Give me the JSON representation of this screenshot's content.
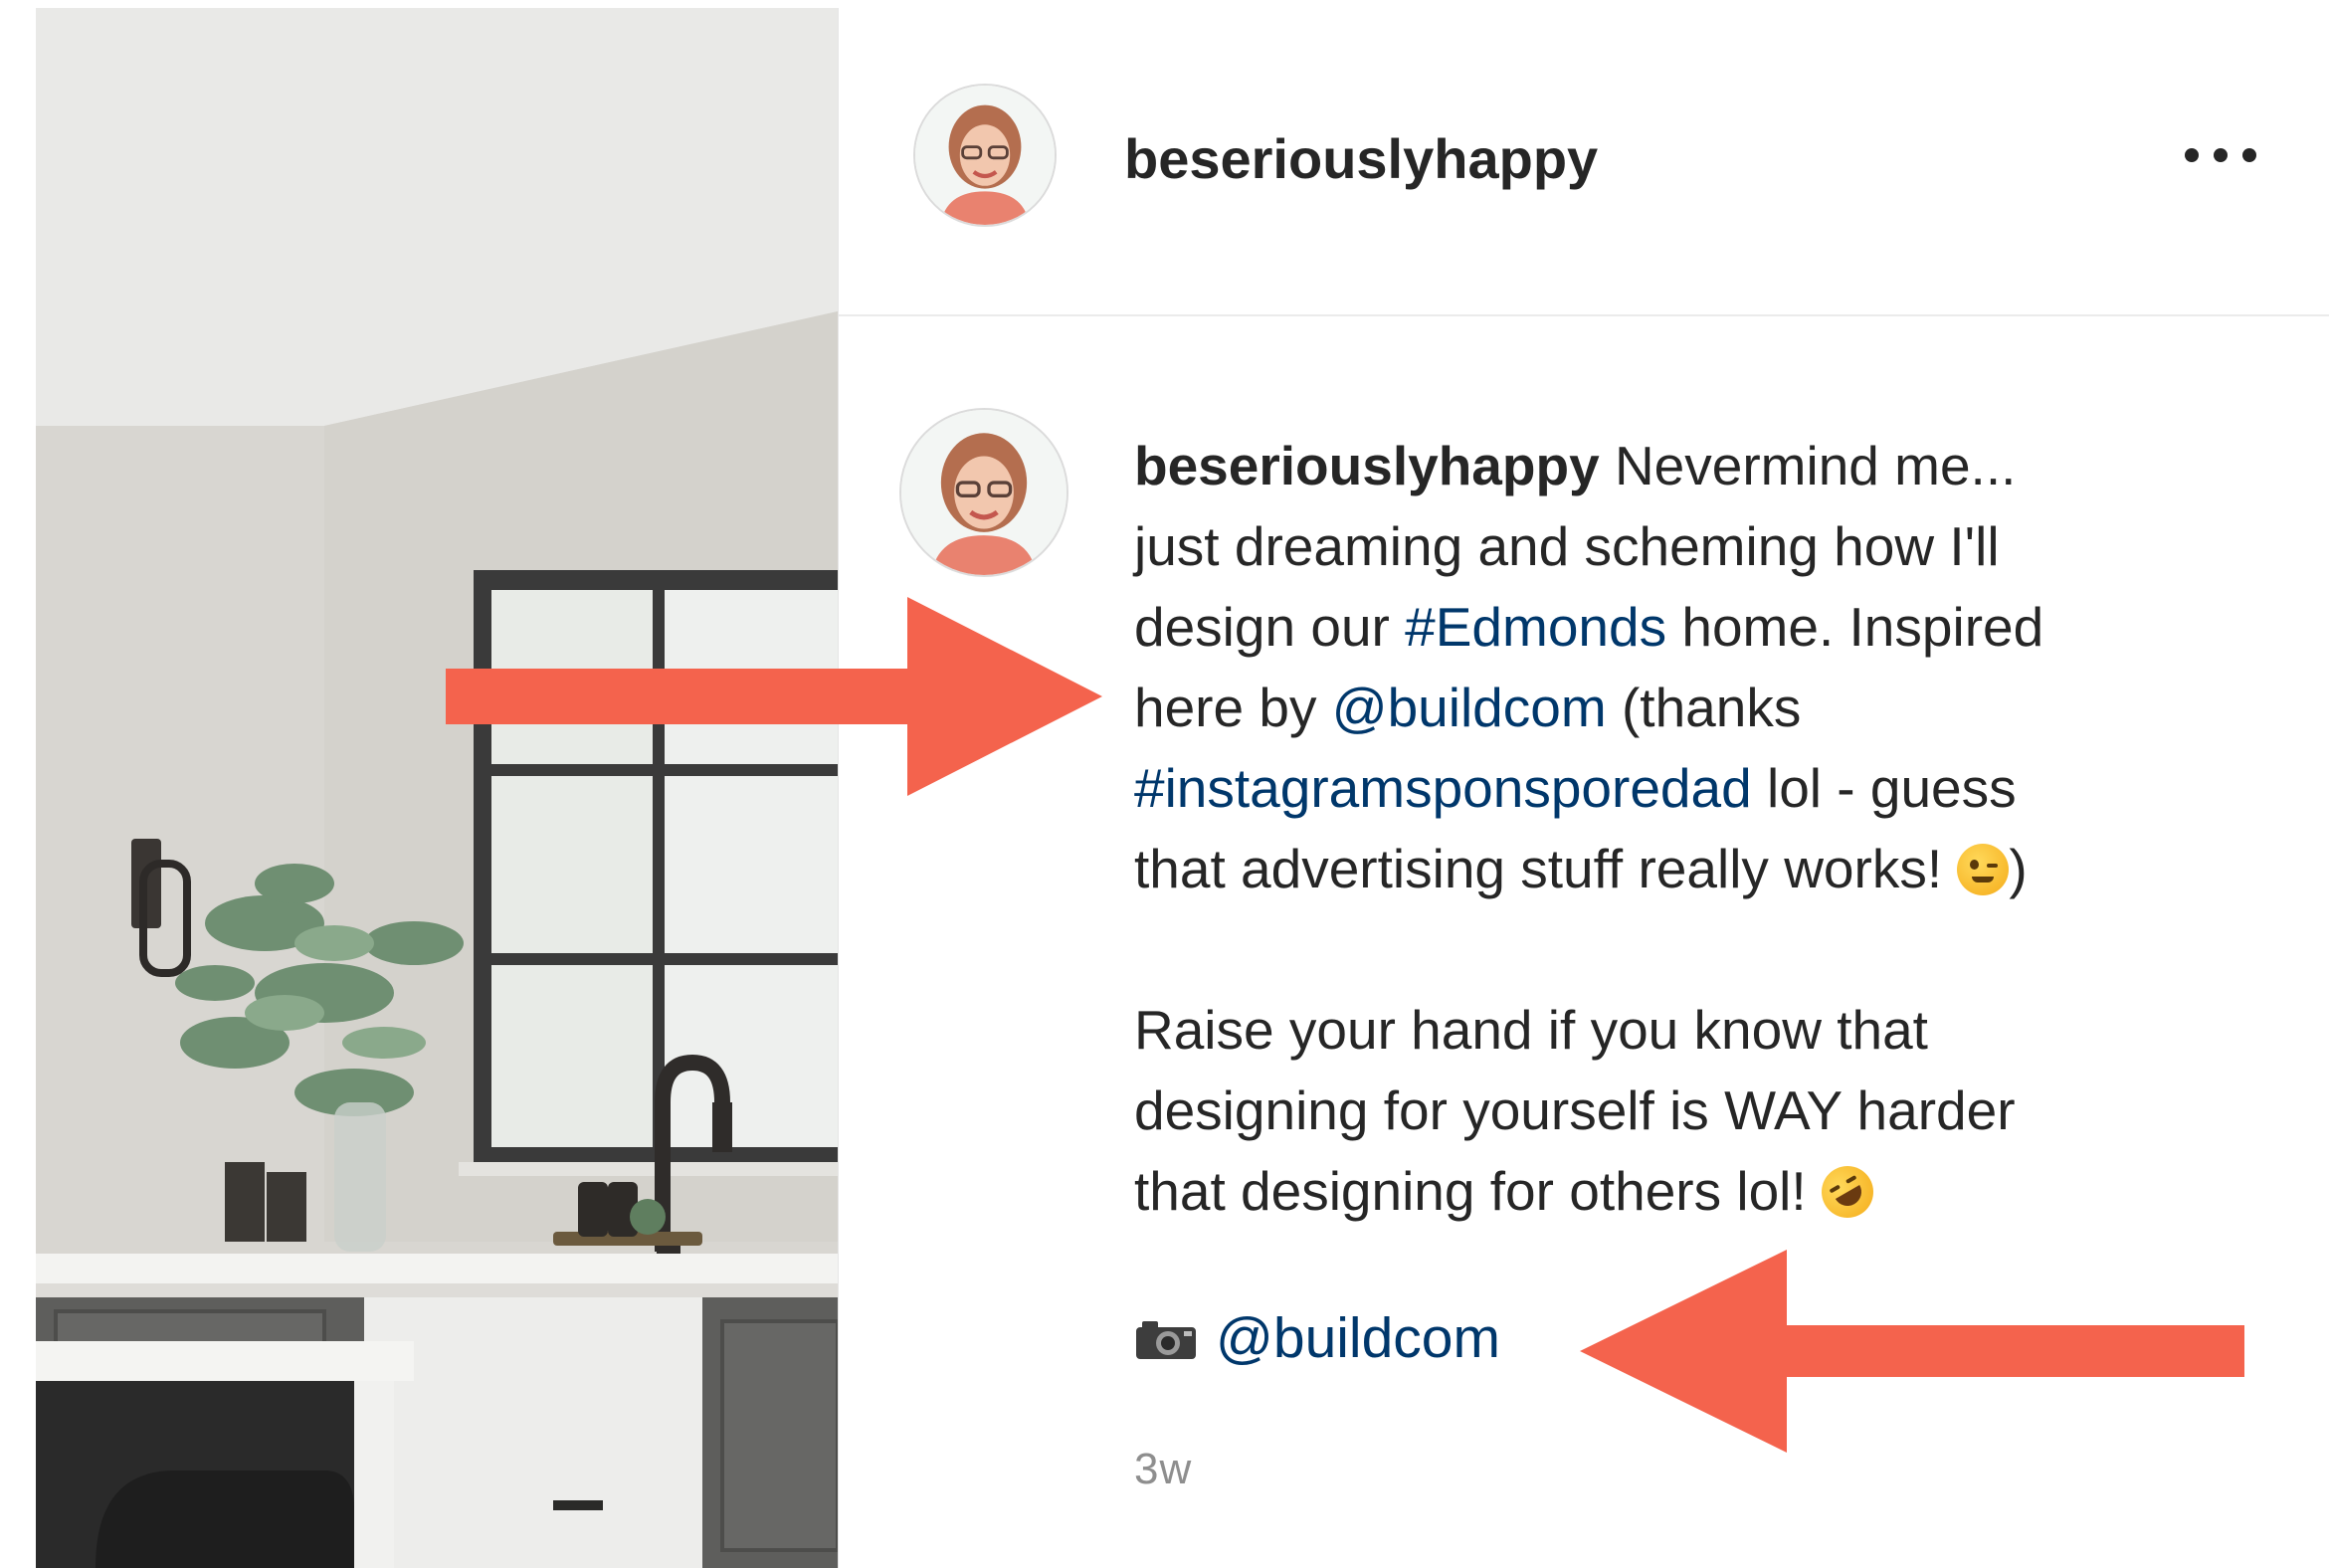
{
  "post": {
    "username": "beseriouslyhappy",
    "caption": {
      "username": "beseriouslyhappy",
      "text_1": " Nevermind me...\njust dreaming and scheming how I'll\ndesign our ",
      "hashtag_1": "#Edmonds",
      "text_2": " home. Inspired\nhere by ",
      "mention_1": "@buildcom",
      "text_3": " (thanks\n",
      "hashtag_2": "#instagramsponsporedad",
      "text_4": " lol - guess\nthat advertising stuff really works! ",
      "text_5": ")",
      "paragraph_2": "Raise your hand if you know that\ndesigning for yourself is WAY harder\nthat designing for others lol! ",
      "credit_mention": "@buildcom"
    },
    "timestamp": "3w"
  },
  "icons": {
    "more": "more-options-icon",
    "camera": "camera-icon",
    "wink_emoji": "winking-face-emoji",
    "laugh_emoji": "rolling-on-floor-laughing-emoji"
  },
  "colors": {
    "link": "#00376b",
    "arrow": "#f4634d",
    "text": "#262626",
    "muted": "#8e8e8e"
  }
}
